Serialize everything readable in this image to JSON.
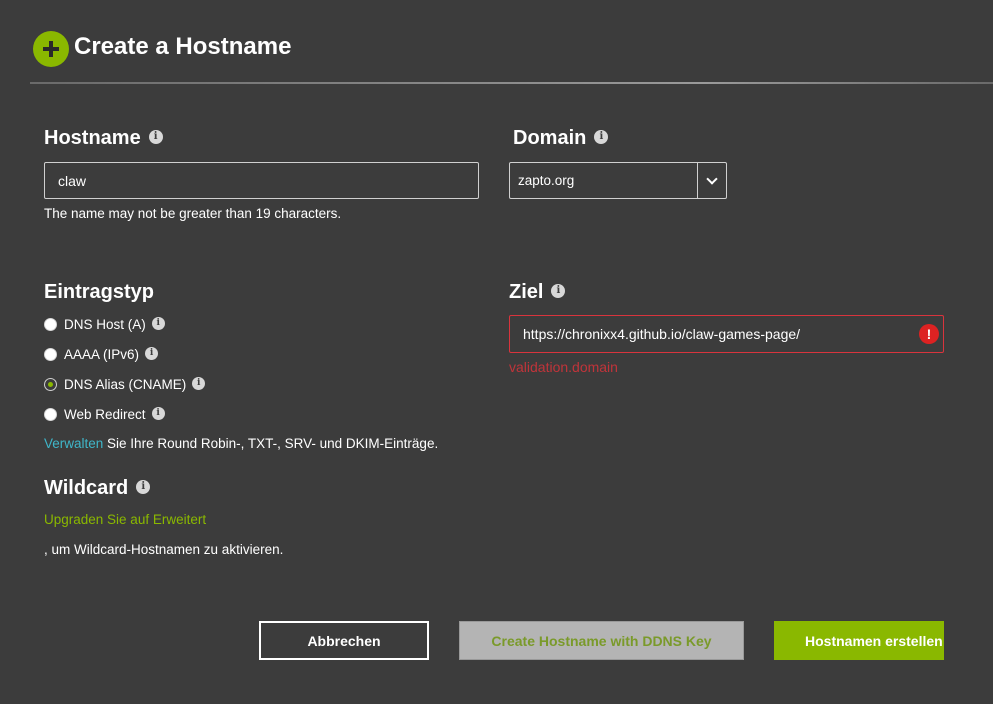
{
  "header": {
    "title": "Create a Hostname"
  },
  "hostname": {
    "label": "Hostname",
    "value": "claw",
    "helper": "The name may not be greater than 19 characters."
  },
  "domain": {
    "label": "Domain",
    "selected": "zapto.org"
  },
  "record_type": {
    "label": "Eintragstyp",
    "options": [
      {
        "label": "DNS Host (A)",
        "checked": false
      },
      {
        "label": "AAAA (IPv6)",
        "checked": false
      },
      {
        "label": "DNS Alias (CNAME)",
        "checked": true
      },
      {
        "label": "Web Redirect",
        "checked": false
      }
    ],
    "manage_link": "Verwalten",
    "manage_text": " Sie Ihre Round Robin-, TXT-, SRV- und DKIM-Einträge."
  },
  "target": {
    "label": "Ziel",
    "value": "https://chronixx4.github.io/claw-games-page/",
    "error": "validation.domain"
  },
  "wildcard": {
    "label": "Wildcard",
    "upgrade_link": "Upgraden Sie auf Erweitert",
    "note": ", um Wildcard-Hostnamen zu aktivieren."
  },
  "buttons": {
    "cancel": "Abbrechen",
    "ddns": "Create Hostname with DDNS Key",
    "create": "Hostnamen erstellen"
  },
  "colors": {
    "accent": "#8ab800",
    "link": "#3fb6c9",
    "error": "#d9343d",
    "background": "#3c3c3c"
  },
  "icons": {
    "add": "plus-icon",
    "info": "info-icon",
    "dropdown": "chevron-down-icon",
    "error": "exclamation-icon"
  }
}
